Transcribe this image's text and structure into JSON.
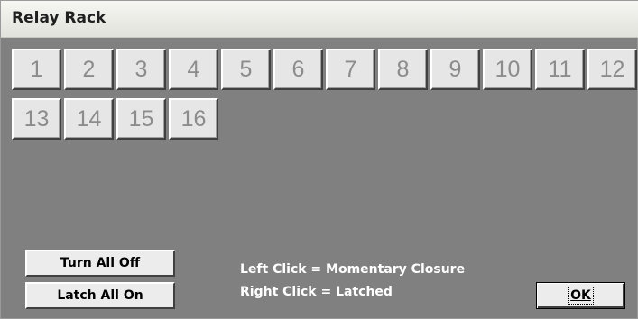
{
  "window": {
    "title": "Relay Rack"
  },
  "relays": [
    "1",
    "2",
    "3",
    "4",
    "5",
    "6",
    "7",
    "8",
    "9",
    "10",
    "11",
    "12",
    "13",
    "14",
    "15",
    "16"
  ],
  "controls": {
    "turn_all_off": "Turn All Off",
    "latch_all_on": "Latch All On"
  },
  "help": {
    "left_click": "Left Click = Momentary Closure",
    "right_click": "Right Click = Latched"
  },
  "dialog": {
    "ok_label": "OK"
  },
  "colors": {
    "panel_background": "#808080",
    "button_face": "#e6e6e6",
    "relay_number_text": "#8c8c8c",
    "help_text": "#ffffff"
  }
}
